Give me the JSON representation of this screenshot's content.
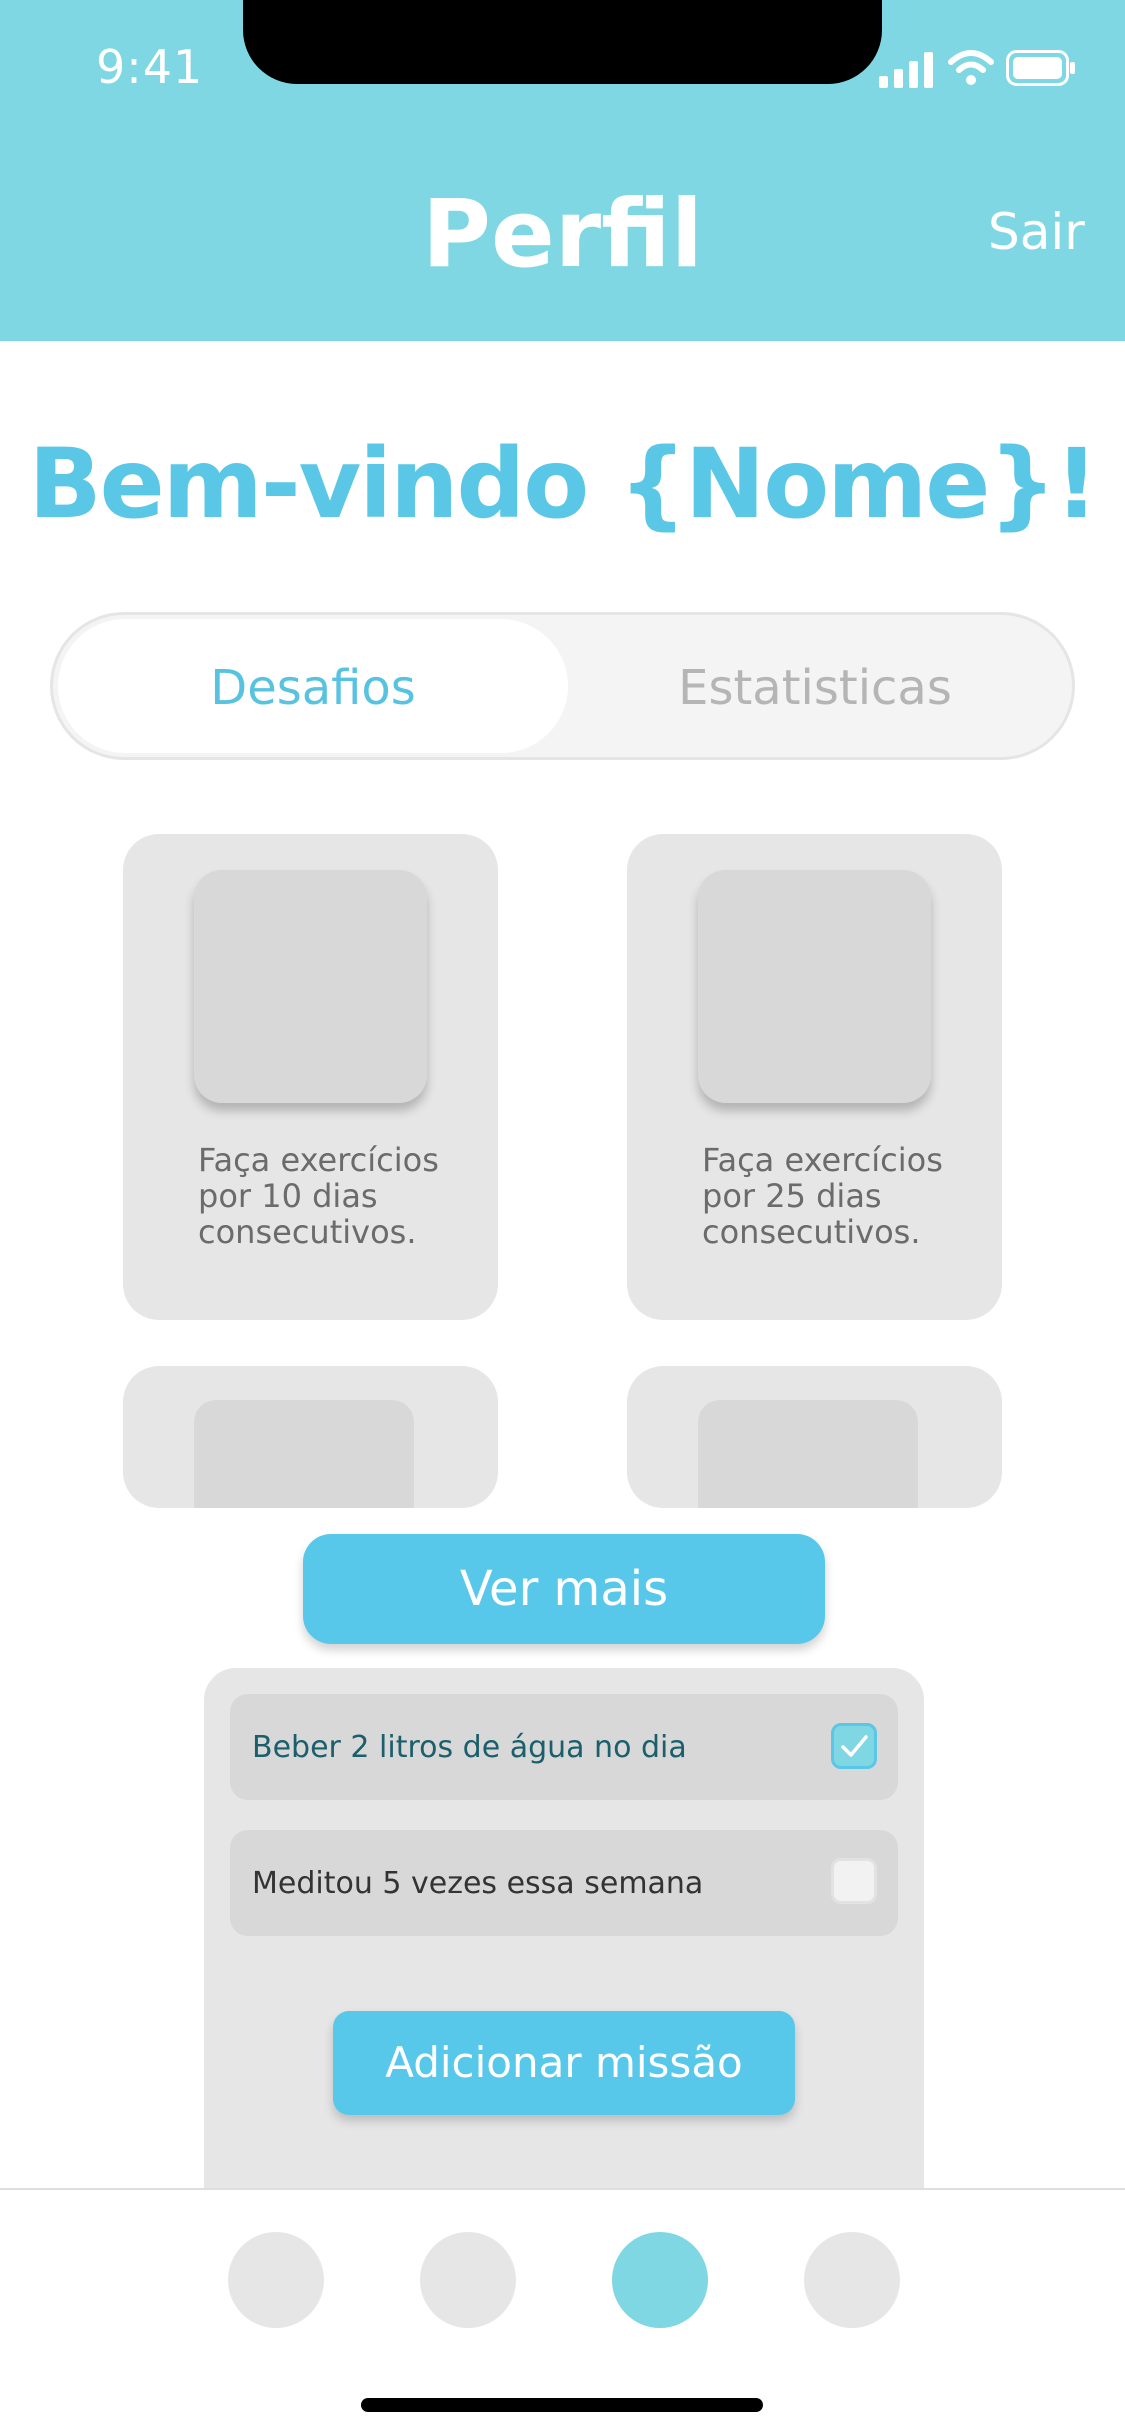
{
  "status_bar": {
    "time": "9:41"
  },
  "header": {
    "title": "Perfil",
    "logout_label": "Sair"
  },
  "welcome": {
    "text": "Bem-vindo {Nome}!"
  },
  "tabs": [
    {
      "label": "Desafios",
      "active": true
    },
    {
      "label": "Estatisticas",
      "active": false
    }
  ],
  "challenges": [
    {
      "text": "Faça exercícios por 10 dias consecutivos."
    },
    {
      "text": "Faça exercícios por 25 dias consecutivos."
    }
  ],
  "see_more_label": "Ver mais",
  "missions": [
    {
      "text": "Beber 2 litros de água no dia",
      "checked": true
    },
    {
      "text": "Meditou 5 vezes essa semana",
      "checked": false
    }
  ],
  "add_mission_label": "Adicionar missão",
  "bottom_nav": {
    "active_index": 2
  },
  "colors": {
    "header_bg": "#7fd7e3",
    "accent": "#58c8ea",
    "title_accent": "#5bc7e6"
  }
}
